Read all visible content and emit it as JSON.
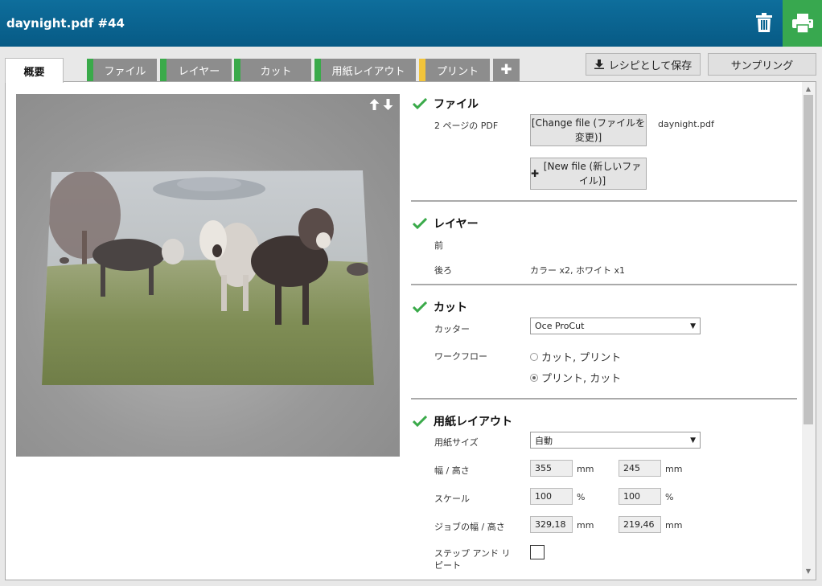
{
  "header": {
    "title": "daynight.pdf #44"
  },
  "tabs": [
    {
      "label": "概要",
      "stripe": ""
    },
    {
      "label": "ファイル",
      "stripe": "#3aaa4a"
    },
    {
      "label": "レイヤー",
      "stripe": "#3aaa4a"
    },
    {
      "label": "カット",
      "stripe": "#3aaa4a"
    },
    {
      "label": "用紙レイアウト",
      "stripe": "#3aaa4a"
    },
    {
      "label": "プリント",
      "stripe": "#f2c43a"
    }
  ],
  "toolbar": {
    "save_recipe_label": "レシピとして保存",
    "sampling_label": "サンプリング"
  },
  "file_section": {
    "title": "ファイル",
    "pages_text": "2 ページの PDF",
    "change_file_label": "[Change file (ファイルを変更)]",
    "new_file_label": "[New file (新しいファイル)]",
    "filename": "daynight.pdf"
  },
  "layer_section": {
    "title": "レイヤー",
    "front_label": "前",
    "back_label": "後ろ",
    "back_value": "カラー x2, ホワイト x1"
  },
  "cut_section": {
    "title": "カット",
    "cutter_label": "カッター",
    "cutter_value": "Oce ProCut",
    "workflow_label": "ワークフロー",
    "workflow_options": [
      "カット, プリント",
      "プリント, カット"
    ],
    "workflow_selected": "プリント, カット"
  },
  "paper_section": {
    "title": "用紙レイアウト",
    "paper_size_label": "用紙サイズ",
    "paper_size_value": "自動",
    "width_height_label": "幅 / 高さ",
    "width": "355",
    "height": "245",
    "scale_label": "スケール",
    "scale_x": "100",
    "scale_y": "100",
    "job_wh_label": "ジョブの幅 / 高さ",
    "job_width": "329,18",
    "job_height": "219,46",
    "step_repeat_label": "ステップ アンド リピート",
    "unit_mm": "mm",
    "unit_pct": "%"
  },
  "colors": {
    "header": "#0a6591",
    "print_green": "#38a84f",
    "check_green": "#3aaa4a",
    "tab_gray": "#8d8d8d",
    "tab_yellow": "#f2c43a"
  }
}
